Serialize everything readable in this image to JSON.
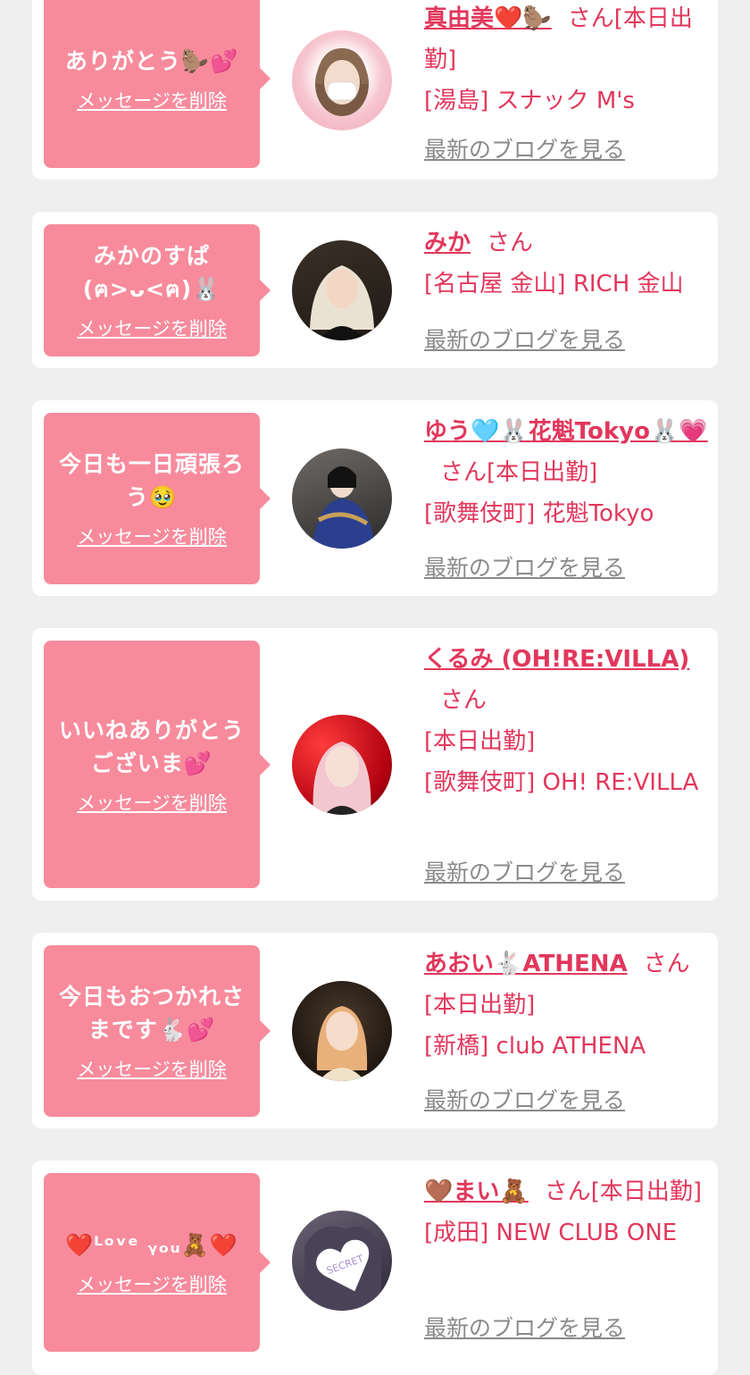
{
  "delete_label": "メッセージを削除",
  "blog_label": "最新のブログを見る",
  "san_label": "さん",
  "items": [
    {
      "message": "ありがとう🦫💕",
      "name": "真由美❤️🦫",
      "status": "[本日出勤]",
      "location": "[湯島] スナック M's",
      "avatar_icon": "avatar-photo"
    },
    {
      "message": "みかのすぱ(ฅ>ᴗ<ฅ)🐰",
      "name": "みか",
      "status": "",
      "location": "[名古屋 金山] RICH 金山",
      "avatar_icon": "avatar-photo"
    },
    {
      "message": "今日も一日頑張ろう🥹",
      "name": "ゆう🩵🐰花魁Tokyo🐰💗",
      "status": "[本日出勤]",
      "location": "[歌舞伎町] 花魁Tokyo",
      "avatar_icon": "avatar-photo"
    },
    {
      "message": "いいねありがとうございま💕",
      "name": "くるみ (OH!RE:VILLA)",
      "status": "[本日出勤]",
      "location": "[歌舞伎町] OH! RE:VILLA",
      "avatar_icon": "avatar-photo"
    },
    {
      "message": "今日もおつかれさまです🐇💕",
      "name": "あおい🐇ATHENA",
      "status": "[本日出勤]",
      "location": "[新橋] club ATHENA",
      "avatar_icon": "avatar-photo"
    },
    {
      "message": "❤️ᴸᵒᵛᵉ ᵧₒᵤ🧸❤️",
      "name": "🤎まい🧸",
      "status": "[本日出勤]",
      "location": "[成田] NEW CLUB ONE",
      "avatar_icon": "avatar-secret-heart",
      "avatar_text": "SECRET"
    }
  ],
  "colors": {
    "accent": "#e2375c",
    "bubble": "#f78b9c",
    "background": "#efefef"
  }
}
